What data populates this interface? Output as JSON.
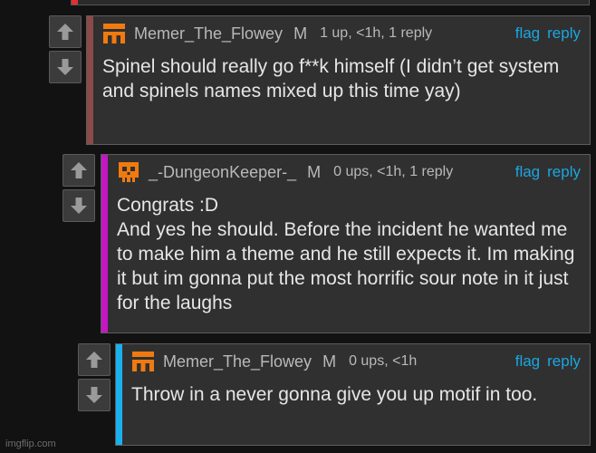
{
  "colors": {
    "background": "#121212",
    "panel": "#303030",
    "link": "#1aa7e2",
    "stripe_red": "#e03030",
    "stripe_brown": "#8a4a48",
    "stripe_magenta": "#c417c4",
    "stripe_blue": "#1ab0ee",
    "avatar_orange": "#f07a10"
  },
  "comments": [
    {
      "username": "Memer_The_Flowey",
      "mod_badge": "M",
      "meta": "1 up, <1h, 1 reply",
      "flag": "flag",
      "reply": "reply",
      "lines": [
        "Spinel should really go f**k himself (I didn’t get system and spinels names mixed up this time yay)"
      ],
      "avatar_icon": "orange-pixel-avatar-icon"
    },
    {
      "username": "_-DungeonKeeper-_",
      "mod_badge": "M",
      "meta": "0 ups, <1h, 1 reply",
      "flag": "flag",
      "reply": "reply",
      "lines": [
        "Congrats :D",
        "And yes he should. Before the incident he wanted me to make him a theme and he still expects it. Im making it but im gonna put the most horrific sour note in it just for the laughs"
      ],
      "avatar_icon": "orange-skull-avatar-icon"
    },
    {
      "username": "Memer_The_Flowey",
      "mod_badge": "M",
      "meta": "0 ups, <1h",
      "flag": "flag",
      "reply": "reply",
      "lines": [
        "Throw in a never gonna give you up motif in too."
      ],
      "avatar_icon": "orange-pixel-avatar-icon"
    }
  ],
  "watermark": "imgflip.com"
}
